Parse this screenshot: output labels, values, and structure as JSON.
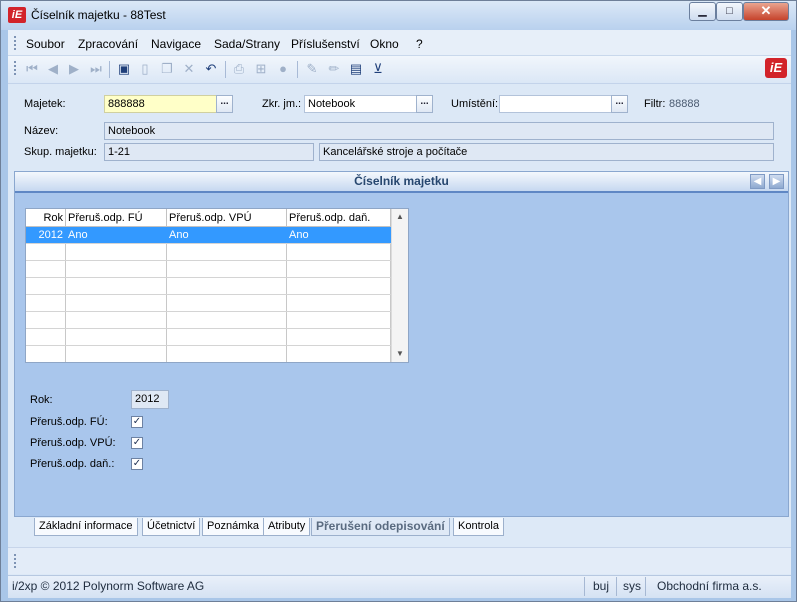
{
  "window": {
    "title": "Číselník majetku - 88Test",
    "app_icon": "iE"
  },
  "menu": {
    "items": [
      "Soubor",
      "Zpracování",
      "Navigace",
      "Sada/Strany",
      "Příslušenství",
      "Okno",
      "?"
    ]
  },
  "toolbar": {
    "icons": [
      "first-record-icon",
      "previous-record-icon",
      "next-record-icon",
      "last-record-icon",
      "save-icon",
      "new-icon",
      "copy-icon",
      "delete-icon",
      "undo-icon",
      "print-icon",
      "tree-icon",
      "refresh-icon",
      "edit-icon",
      "pencil-icon",
      "table-icon",
      "filter-icon"
    ]
  },
  "form": {
    "majetek_label": "Majetek:",
    "majetek_value": "888888",
    "zkr_label": "Zkr. jm.:",
    "zkr_value": "Notebook",
    "umisteni_label": "Umístění:",
    "umisteni_value": "",
    "filtr_label": "Filtr:",
    "filtr_value": "88888",
    "nazev_label": "Název:",
    "nazev_value": "Notebook",
    "skup_label": "Skup. majetku:",
    "skup_code": "1-21",
    "skup_name": "Kancelářské stroje a počítače",
    "browse_label": "..."
  },
  "panel": {
    "title": "Číselník majetku",
    "grid": {
      "columns": [
        "Rok",
        "Přeruš.odp. FÚ",
        "Přeruš.odp. VPÚ",
        "Přeruš.odp. daň."
      ],
      "rows": [
        [
          "2012",
          "Ano",
          "Ano",
          "Ano"
        ]
      ],
      "empty_rows": 7
    },
    "detail": {
      "rok_label": "Rok:",
      "rok_value": "2012",
      "fu_label": "Přeruš.odp. FÚ:",
      "fu_checked": true,
      "vpu_label": "Přeruš.odp. VPÚ:",
      "vpu_checked": true,
      "dan_label": "Přeruš.odp. daň.:",
      "dan_checked": true
    }
  },
  "tabs": [
    "Základní informace",
    "Účetnictví",
    "Poznámka",
    "Atributy",
    "Přerušení odepisování",
    "Kontrola"
  ],
  "active_tab": "Přerušení odepisování",
  "status": {
    "copyright": "i/2xp © 2012 Polynorm Software AG",
    "user": "buj",
    "db": "sys",
    "company": "Obchodní firma a.s."
  }
}
